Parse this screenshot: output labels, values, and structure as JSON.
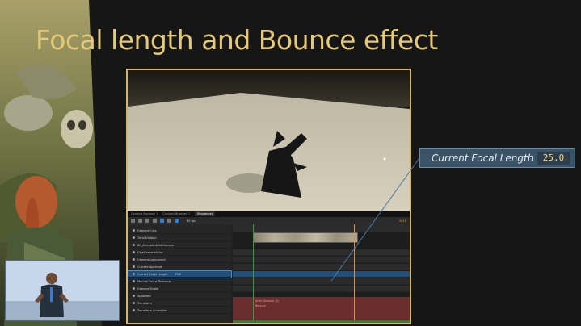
{
  "slide": {
    "title": "Focal length and Bounce effect"
  },
  "callout": {
    "label": "Current Focal Length",
    "value": "25.0"
  },
  "sequencer": {
    "tabs": [
      "Content Browser 1",
      "Content Browser 2",
      "Sequencer"
    ],
    "active_tab_index": 2,
    "fps_label": "30 fps",
    "timecode": "0045",
    "rows": [
      {
        "label": "Camera Cuts",
        "value": ""
      },
      {
        "label": "Time Dilation",
        "value": ""
      },
      {
        "label": "BP_AnimatedLinkCamera",
        "value": ""
      },
      {
        "label": "CineCameraActor",
        "value": ""
      },
      {
        "label": "CameraComponent",
        "value": ""
      },
      {
        "label": "Current Aperture",
        "value": ""
      },
      {
        "label": "Current Focal Length",
        "value": "25.0"
      },
      {
        "label": "Manual Focus Distance",
        "value": ""
      },
      {
        "label": "Camera Shake",
        "value": ""
      },
      {
        "label": "Spawned",
        "value": ""
      },
      {
        "label": "Transform",
        "value": ""
      },
      {
        "label": "Transform Animation",
        "value": ""
      }
    ],
    "red_labels": [
      "Anim_Bounce_01",
      "Bounce"
    ],
    "highlight_row_index": 6
  },
  "colors": {
    "title_gold": "#e4c97a",
    "border_gold": "#d7b562",
    "callout_bg": "#3b5367",
    "callout_value": "#ffd97a",
    "selection_blue": "#1f4f7a"
  }
}
